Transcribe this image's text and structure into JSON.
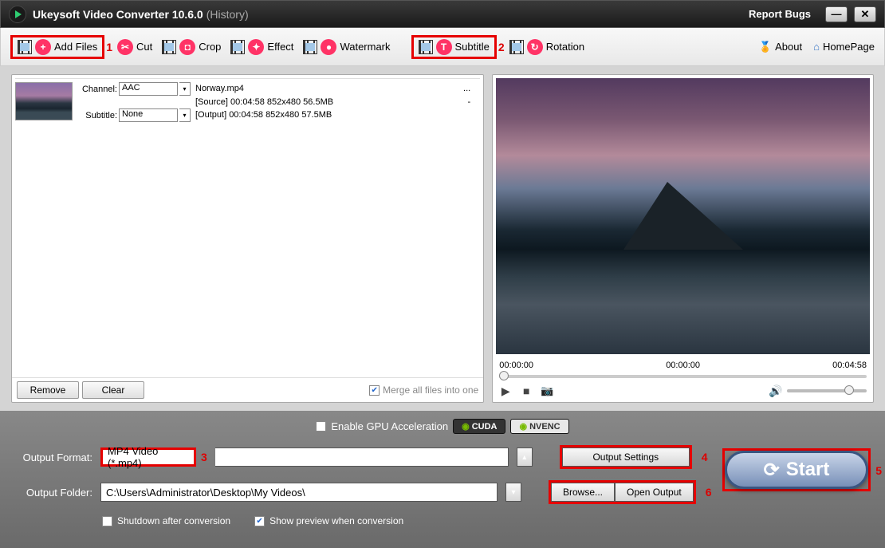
{
  "titlebar": {
    "title": "Ukeysoft Video Converter 10.6.0",
    "history": "(History)",
    "report": "Report Bugs"
  },
  "toolbar": {
    "add_files": "Add Files",
    "cut": "Cut",
    "crop": "Crop",
    "effect": "Effect",
    "watermark": "Watermark",
    "subtitle": "Subtitle",
    "rotation": "Rotation",
    "about": "About",
    "homepage": "HomePage"
  },
  "annotations": {
    "n1": "1",
    "n2": "2",
    "n3": "3",
    "n4": "4",
    "n5": "5",
    "n6": "6"
  },
  "file": {
    "channel_label": "Channel:",
    "channel_value": "AAC",
    "subtitle_label": "Subtitle:",
    "subtitle_value": "None",
    "name": "Norway.mp4",
    "source_line": "[Source] 00:04:58 852x480 56.5MB",
    "output_line": "[Output] 00:04:58 852x480 57.5MB",
    "dots": "...",
    "dash": "-"
  },
  "left_footer": {
    "remove": "Remove",
    "clear": "Clear",
    "merge": "Merge all files into one"
  },
  "preview": {
    "t1": "00:00:00",
    "t2": "00:00:00",
    "t3": "00:04:58"
  },
  "bottom": {
    "gpu_label": "Enable GPU Acceleration",
    "cuda": "CUDA",
    "nvenc": "NVENC",
    "format_label": "Output Format:",
    "format_value": "MP4 Video (*.mp4)",
    "output_settings": "Output Settings",
    "folder_label": "Output Folder:",
    "folder_value": "C:\\Users\\Administrator\\Desktop\\My Videos\\",
    "browse": "Browse...",
    "open_output": "Open Output",
    "shutdown": "Shutdown after conversion",
    "preview": "Show preview when conversion",
    "start": "Start"
  }
}
